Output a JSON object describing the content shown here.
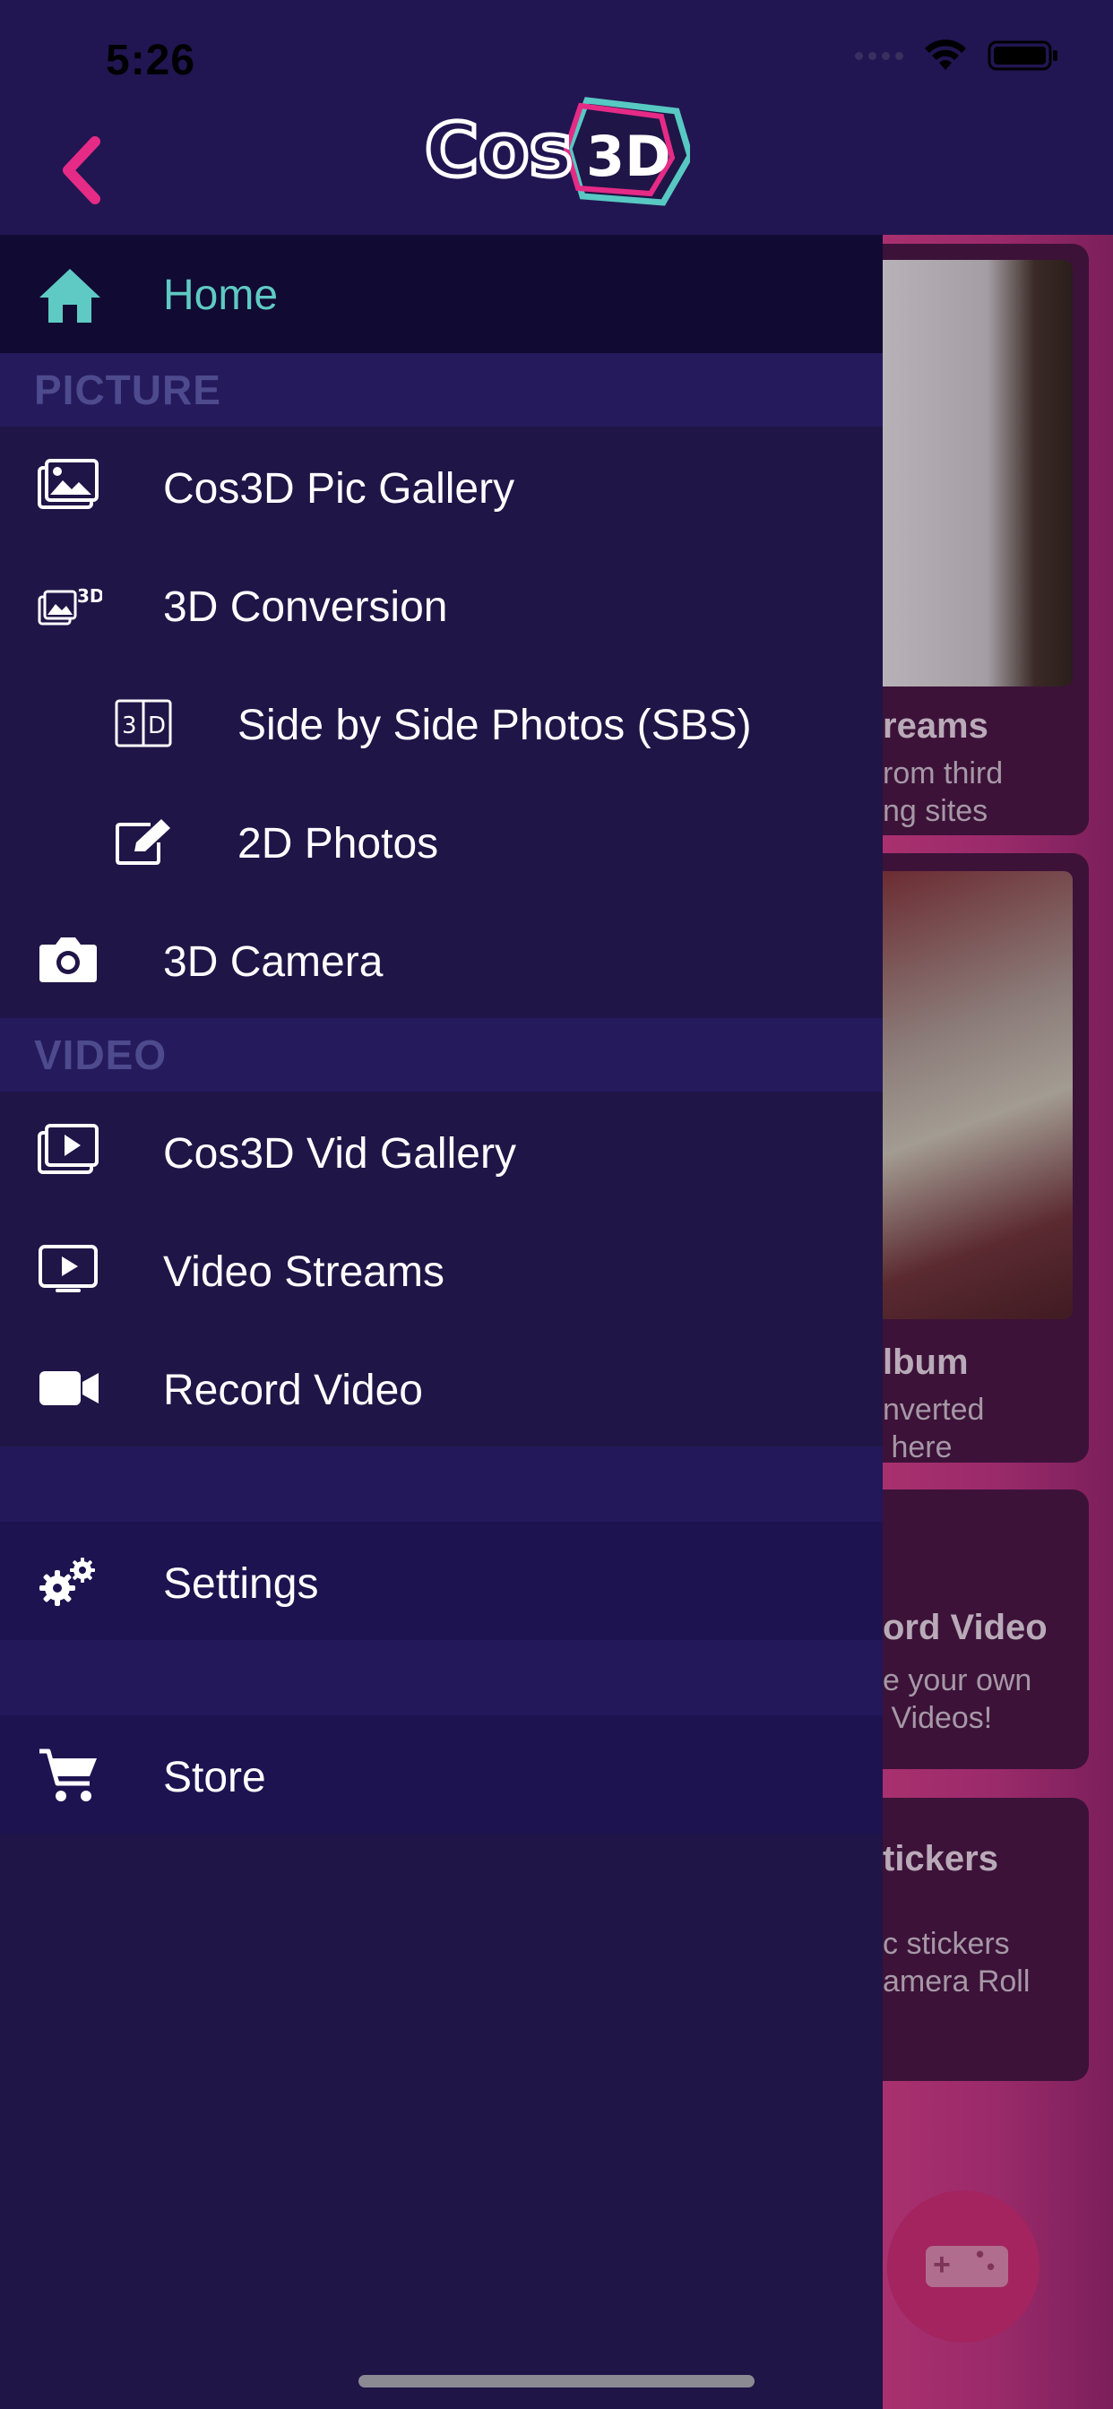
{
  "status": {
    "time": "5:26"
  },
  "header": {
    "logo_text_left": "Cos",
    "logo_text_right": "3D"
  },
  "menu": {
    "home": "Home",
    "picture_section": "PICTURE",
    "pic_gallery": "Cos3D Pic Gallery",
    "conversion": "3D Conversion",
    "sbs": "Side by Side Photos (SBS)",
    "photos_2d": "2D Photos",
    "camera": "3D Camera",
    "video_section": "VIDEO",
    "vid_gallery": "Cos3D Vid Gallery",
    "video_streams": "Video Streams",
    "record_video": "Record Video",
    "settings": "Settings",
    "store": "Store"
  },
  "background_cards": [
    {
      "title": "reams",
      "sub": "rom third\nng sites"
    },
    {
      "title": "lbum",
      "sub": "nverted\n here"
    },
    {
      "title": "ord Video",
      "sub": "e your own\n Videos!"
    },
    {
      "title": "tickers",
      "sub": "c stickers\namera Roll"
    }
  ],
  "colors": {
    "accent": "#5fcac4",
    "brand_pink": "#e52b86",
    "bg": "#1f1547"
  }
}
